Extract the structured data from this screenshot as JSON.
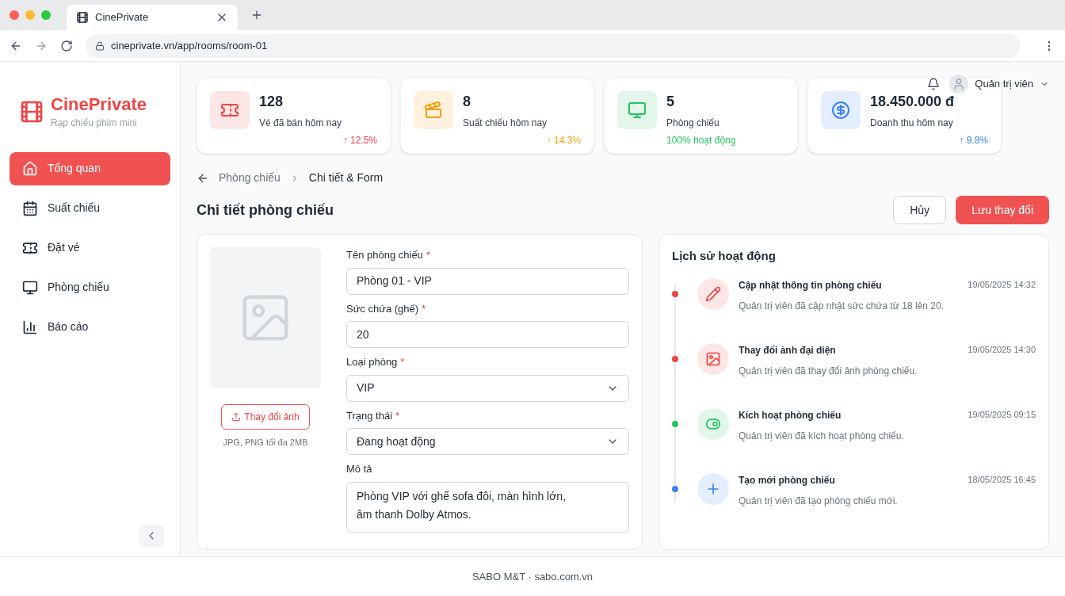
{
  "browser": {
    "tab_title": "CinePrivate",
    "url": "cineprivate.vn/app/rooms/room-01"
  },
  "brand": {
    "name": "CinePrivate",
    "tagline": "Rạp chiếu phim mini"
  },
  "sidebar": {
    "items": [
      {
        "label": "Tổng quan",
        "selected": true
      },
      {
        "label": "Suất chiếu",
        "selected": false
      },
      {
        "label": "Đặt vé",
        "selected": false
      },
      {
        "label": "Phòng chiếu",
        "selected": false
      },
      {
        "label": "Báo cáo",
        "selected": false
      }
    ]
  },
  "user": {
    "name": "Quản trị viên"
  },
  "stats": [
    {
      "color": "#ef4444",
      "value": "128",
      "label": "Vé đã bán hôm nay",
      "change": "↑ 12.5%"
    },
    {
      "color": "#f59e0b",
      "value": "8",
      "label": "Suất chiếu hôm nay",
      "change": "↑ 14.3%"
    },
    {
      "color": "#22c55e",
      "value": "5",
      "label": "Phòng chiếu",
      "change": "100% hoạt động"
    },
    {
      "color": "#3b82f6",
      "value": "18.450.000 đ",
      "label": "Doanh thu hôm nay",
      "change": "↑ 9.8%"
    }
  ],
  "breadcrumb": [
    "Phòng chiếu",
    "Chi tiết & Form"
  ],
  "page_title": "Chi tiết phòng chiếu",
  "actions": {
    "cancel": "Hủy",
    "save": "Lưu thay đổi"
  },
  "image": {
    "button": "Thay đổi ảnh",
    "hint": "JPG, PNG tối đa 2MB"
  },
  "form": [
    {
      "kind": "text",
      "label": "Tên phòng chiếu",
      "required_mark": "*",
      "value": "Phòng 01 - VIP"
    },
    {
      "kind": "text",
      "label": "Sức chứa (ghế)",
      "required_mark": "*",
      "value": "20"
    },
    {
      "kind": "select",
      "label": "Loại phòng",
      "required_mark": "*",
      "value": "VIP"
    },
    {
      "kind": "select",
      "label": "Trạng thái",
      "required_mark": "*",
      "value": "Đang hoạt động"
    },
    {
      "kind": "textarea",
      "label": "Mô tả",
      "value": "Phòng VIP với ghế sofa đôi, màn hình lớn,\nâm thanh Dolby Atmos."
    }
  ],
  "activity": {
    "title": "Lịch sử hoạt động",
    "items": [
      {
        "color": "#ef4444",
        "title": "Cập nhật thông tin phòng chiếu",
        "time": "19/05/2025 14:32",
        "detail": "Quản trị viên đã cập nhật sức chứa từ 18 lên 20."
      },
      {
        "color": "#ef4444",
        "title": "Thay đổi ảnh đại diện",
        "time": "19/05/2025 14:30",
        "detail": "Quản trị viên đã thay đổi ảnh phòng chiếu."
      },
      {
        "color": "#22c55e",
        "title": "Kích hoạt phòng chiếu",
        "time": "19/05/2025 09:15",
        "detail": "Quản trị viên đã kích hoạt phòng chiếu."
      },
      {
        "color": "#3b82f6",
        "title": "Tạo mới phòng chiếu",
        "time": "18/05/2025 16:45",
        "detail": "Quản trị viên đã tạo phòng chiếu mới."
      }
    ]
  },
  "footer": "SABO M&T · sabo.com.vn"
}
